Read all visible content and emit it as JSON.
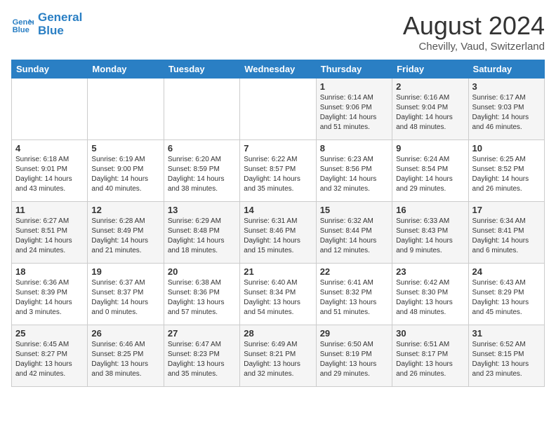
{
  "logo": {
    "line1": "General",
    "line2": "Blue"
  },
  "title": "August 2024",
  "location": "Chevilly, Vaud, Switzerland",
  "days_of_week": [
    "Sunday",
    "Monday",
    "Tuesday",
    "Wednesday",
    "Thursday",
    "Friday",
    "Saturday"
  ],
  "weeks": [
    [
      {
        "day": "",
        "content": ""
      },
      {
        "day": "",
        "content": ""
      },
      {
        "day": "",
        "content": ""
      },
      {
        "day": "",
        "content": ""
      },
      {
        "day": "1",
        "content": "Sunrise: 6:14 AM\nSunset: 9:06 PM\nDaylight: 14 hours\nand 51 minutes."
      },
      {
        "day": "2",
        "content": "Sunrise: 6:16 AM\nSunset: 9:04 PM\nDaylight: 14 hours\nand 48 minutes."
      },
      {
        "day": "3",
        "content": "Sunrise: 6:17 AM\nSunset: 9:03 PM\nDaylight: 14 hours\nand 46 minutes."
      }
    ],
    [
      {
        "day": "4",
        "content": "Sunrise: 6:18 AM\nSunset: 9:01 PM\nDaylight: 14 hours\nand 43 minutes."
      },
      {
        "day": "5",
        "content": "Sunrise: 6:19 AM\nSunset: 9:00 PM\nDaylight: 14 hours\nand 40 minutes."
      },
      {
        "day": "6",
        "content": "Sunrise: 6:20 AM\nSunset: 8:59 PM\nDaylight: 14 hours\nand 38 minutes."
      },
      {
        "day": "7",
        "content": "Sunrise: 6:22 AM\nSunset: 8:57 PM\nDaylight: 14 hours\nand 35 minutes."
      },
      {
        "day": "8",
        "content": "Sunrise: 6:23 AM\nSunset: 8:56 PM\nDaylight: 14 hours\nand 32 minutes."
      },
      {
        "day": "9",
        "content": "Sunrise: 6:24 AM\nSunset: 8:54 PM\nDaylight: 14 hours\nand 29 minutes."
      },
      {
        "day": "10",
        "content": "Sunrise: 6:25 AM\nSunset: 8:52 PM\nDaylight: 14 hours\nand 26 minutes."
      }
    ],
    [
      {
        "day": "11",
        "content": "Sunrise: 6:27 AM\nSunset: 8:51 PM\nDaylight: 14 hours\nand 24 minutes."
      },
      {
        "day": "12",
        "content": "Sunrise: 6:28 AM\nSunset: 8:49 PM\nDaylight: 14 hours\nand 21 minutes."
      },
      {
        "day": "13",
        "content": "Sunrise: 6:29 AM\nSunset: 8:48 PM\nDaylight: 14 hours\nand 18 minutes."
      },
      {
        "day": "14",
        "content": "Sunrise: 6:31 AM\nSunset: 8:46 PM\nDaylight: 14 hours\nand 15 minutes."
      },
      {
        "day": "15",
        "content": "Sunrise: 6:32 AM\nSunset: 8:44 PM\nDaylight: 14 hours\nand 12 minutes."
      },
      {
        "day": "16",
        "content": "Sunrise: 6:33 AM\nSunset: 8:43 PM\nDaylight: 14 hours\nand 9 minutes."
      },
      {
        "day": "17",
        "content": "Sunrise: 6:34 AM\nSunset: 8:41 PM\nDaylight: 14 hours\nand 6 minutes."
      }
    ],
    [
      {
        "day": "18",
        "content": "Sunrise: 6:36 AM\nSunset: 8:39 PM\nDaylight: 14 hours\nand 3 minutes."
      },
      {
        "day": "19",
        "content": "Sunrise: 6:37 AM\nSunset: 8:37 PM\nDaylight: 14 hours\nand 0 minutes."
      },
      {
        "day": "20",
        "content": "Sunrise: 6:38 AM\nSunset: 8:36 PM\nDaylight: 13 hours\nand 57 minutes."
      },
      {
        "day": "21",
        "content": "Sunrise: 6:40 AM\nSunset: 8:34 PM\nDaylight: 13 hours\nand 54 minutes."
      },
      {
        "day": "22",
        "content": "Sunrise: 6:41 AM\nSunset: 8:32 PM\nDaylight: 13 hours\nand 51 minutes."
      },
      {
        "day": "23",
        "content": "Sunrise: 6:42 AM\nSunset: 8:30 PM\nDaylight: 13 hours\nand 48 minutes."
      },
      {
        "day": "24",
        "content": "Sunrise: 6:43 AM\nSunset: 8:29 PM\nDaylight: 13 hours\nand 45 minutes."
      }
    ],
    [
      {
        "day": "25",
        "content": "Sunrise: 6:45 AM\nSunset: 8:27 PM\nDaylight: 13 hours\nand 42 minutes."
      },
      {
        "day": "26",
        "content": "Sunrise: 6:46 AM\nSunset: 8:25 PM\nDaylight: 13 hours\nand 38 minutes."
      },
      {
        "day": "27",
        "content": "Sunrise: 6:47 AM\nSunset: 8:23 PM\nDaylight: 13 hours\nand 35 minutes."
      },
      {
        "day": "28",
        "content": "Sunrise: 6:49 AM\nSunset: 8:21 PM\nDaylight: 13 hours\nand 32 minutes."
      },
      {
        "day": "29",
        "content": "Sunrise: 6:50 AM\nSunset: 8:19 PM\nDaylight: 13 hours\nand 29 minutes."
      },
      {
        "day": "30",
        "content": "Sunrise: 6:51 AM\nSunset: 8:17 PM\nDaylight: 13 hours\nand 26 minutes."
      },
      {
        "day": "31",
        "content": "Sunrise: 6:52 AM\nSunset: 8:15 PM\nDaylight: 13 hours\nand 23 minutes."
      }
    ]
  ]
}
